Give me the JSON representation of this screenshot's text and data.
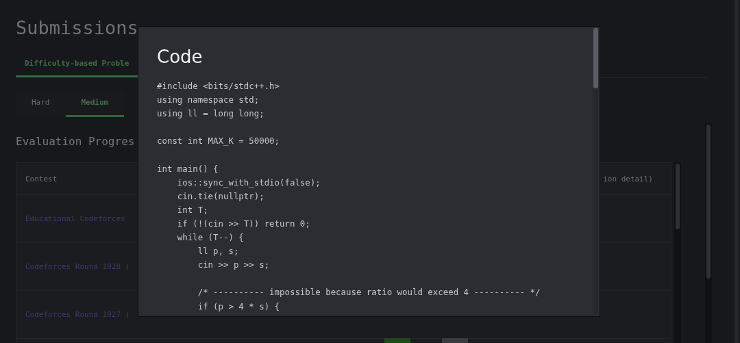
{
  "page": {
    "title": "Submissions"
  },
  "tabs": [
    {
      "label": "Difficulty-based Proble",
      "selected": true
    }
  ],
  "difficulty_tabs": [
    {
      "label": "Hard",
      "selected": false
    },
    {
      "label": "Medium",
      "selected": true
    }
  ],
  "section_title": "Evaluation Progres",
  "table": {
    "columns": [
      "Contest",
      "ion detail)"
    ],
    "rows": [
      {
        "contest": "Educational Codeforces"
      },
      {
        "contest": "Codeforces Round 1028 ("
      },
      {
        "contest": "Codeforces Round 1027 ("
      }
    ]
  },
  "dialog": {
    "title": "Code",
    "code_blocks": [
      [
        "#include <bits/stdc++.h>",
        "using namespace std;",
        "using ll = long long;"
      ],
      [
        "const int MAX_K = 50000;"
      ],
      [
        "int main() {",
        "    ios::sync_with_stdio(false);",
        "    cin.tie(nullptr);",
        "    int T;",
        "    if (!(cin >> T)) return 0;",
        "    while (T--) {",
        "        ll p, s;",
        "        cin >> p >> s;"
      ],
      [
        "        /* ---------- impossible because ratio would exceed 4 ---------- */",
        "        if (p > 4 * s) {"
      ]
    ]
  },
  "bottom_buttons": [
    {
      "kind": "primary"
    },
    {
      "kind": "secondary"
    }
  ]
}
